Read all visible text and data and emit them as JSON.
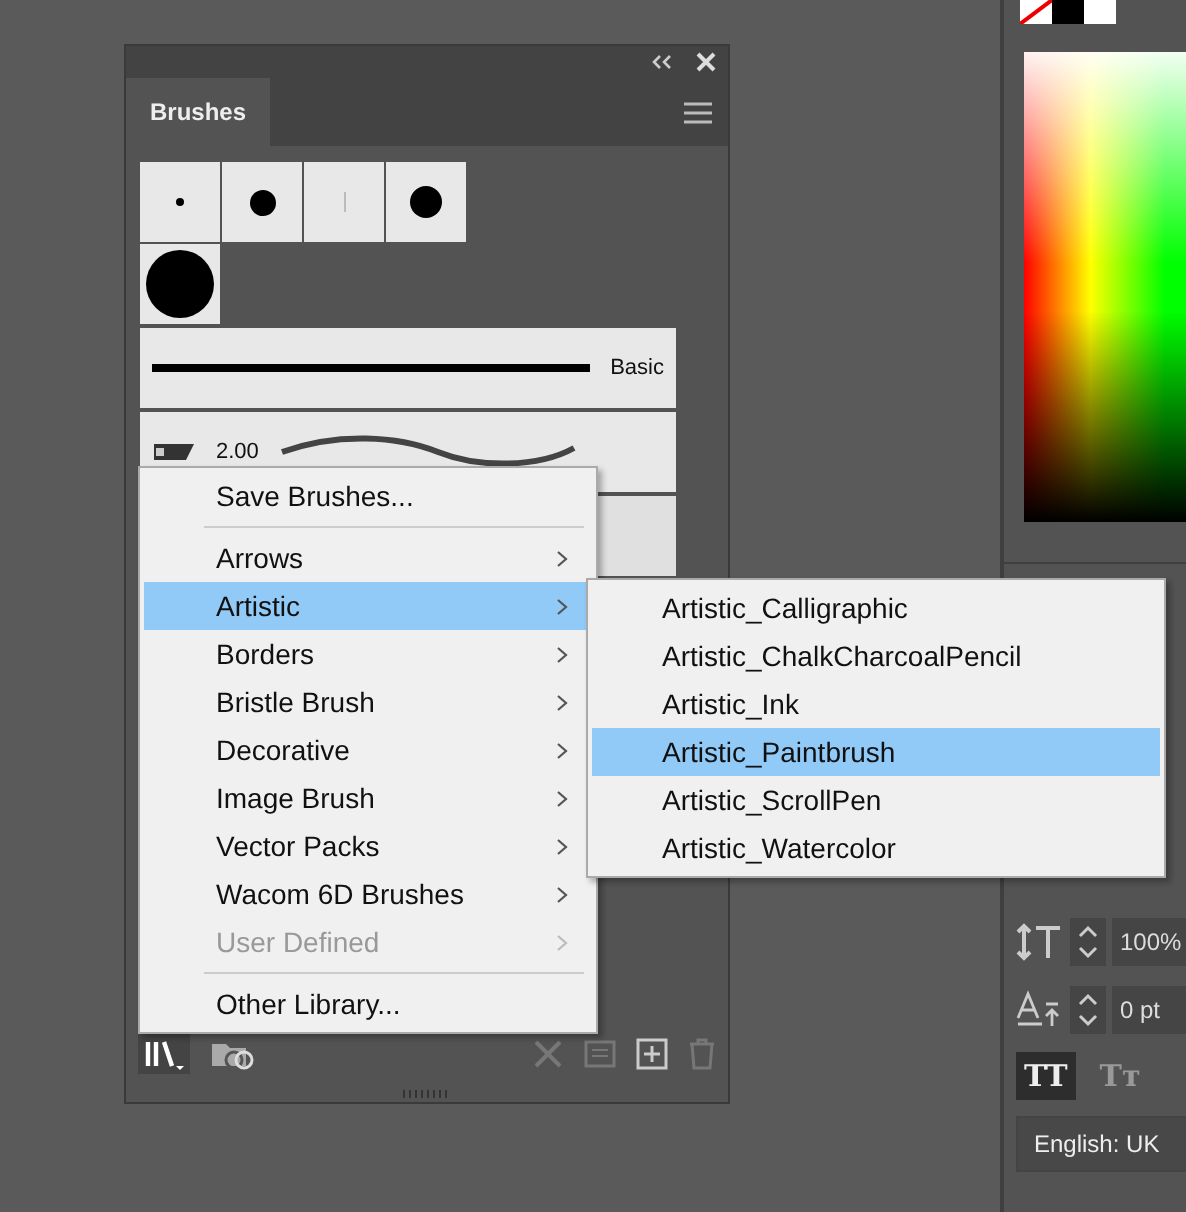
{
  "brushes_panel": {
    "tab": {
      "label": "Brushes",
      "selected": true
    },
    "strokes": [
      {
        "kind": "line",
        "label": "Basic"
      },
      {
        "kind": "calligraphic",
        "label": "2.00"
      }
    ]
  },
  "library_menu": {
    "items": [
      {
        "kind": "item",
        "label": "Save Brushes...",
        "submenu": false,
        "disabled": false,
        "selected": false
      },
      {
        "kind": "separator"
      },
      {
        "kind": "item",
        "label": "Arrows",
        "submenu": true,
        "disabled": false,
        "selected": false
      },
      {
        "kind": "item",
        "label": "Artistic",
        "submenu": true,
        "disabled": false,
        "selected": true
      },
      {
        "kind": "item",
        "label": "Borders",
        "submenu": true,
        "disabled": false,
        "selected": false
      },
      {
        "kind": "item",
        "label": "Bristle Brush",
        "submenu": true,
        "disabled": false,
        "selected": false
      },
      {
        "kind": "item",
        "label": "Decorative",
        "submenu": true,
        "disabled": false,
        "selected": false
      },
      {
        "kind": "item",
        "label": "Image Brush",
        "submenu": true,
        "disabled": false,
        "selected": false
      },
      {
        "kind": "item",
        "label": "Vector Packs",
        "submenu": true,
        "disabled": false,
        "selected": false
      },
      {
        "kind": "item",
        "label": "Wacom 6D Brushes",
        "submenu": true,
        "disabled": false,
        "selected": false
      },
      {
        "kind": "item",
        "label": "User Defined",
        "submenu": true,
        "disabled": true,
        "selected": false
      },
      {
        "kind": "separator"
      },
      {
        "kind": "item",
        "label": "Other Library...",
        "submenu": false,
        "disabled": false,
        "selected": false
      }
    ]
  },
  "submenu": {
    "items": [
      {
        "label": "Artistic_Calligraphic",
        "selected": false
      },
      {
        "label": "Artistic_ChalkCharcoalPencil",
        "selected": false
      },
      {
        "label": "Artistic_Ink",
        "selected": false
      },
      {
        "label": "Artistic_Paintbrush",
        "selected": true
      },
      {
        "label": "Artistic_ScrollPen",
        "selected": false
      },
      {
        "label": "Artistic_Watercolor",
        "selected": false
      }
    ]
  },
  "character_panel": {
    "vertical_scale": "100%",
    "baseline_shift": "0 pt",
    "case_buttons": [
      {
        "label": "TT",
        "selected": true
      },
      {
        "label": "Tт",
        "selected": false
      }
    ],
    "language": "English: UK"
  }
}
